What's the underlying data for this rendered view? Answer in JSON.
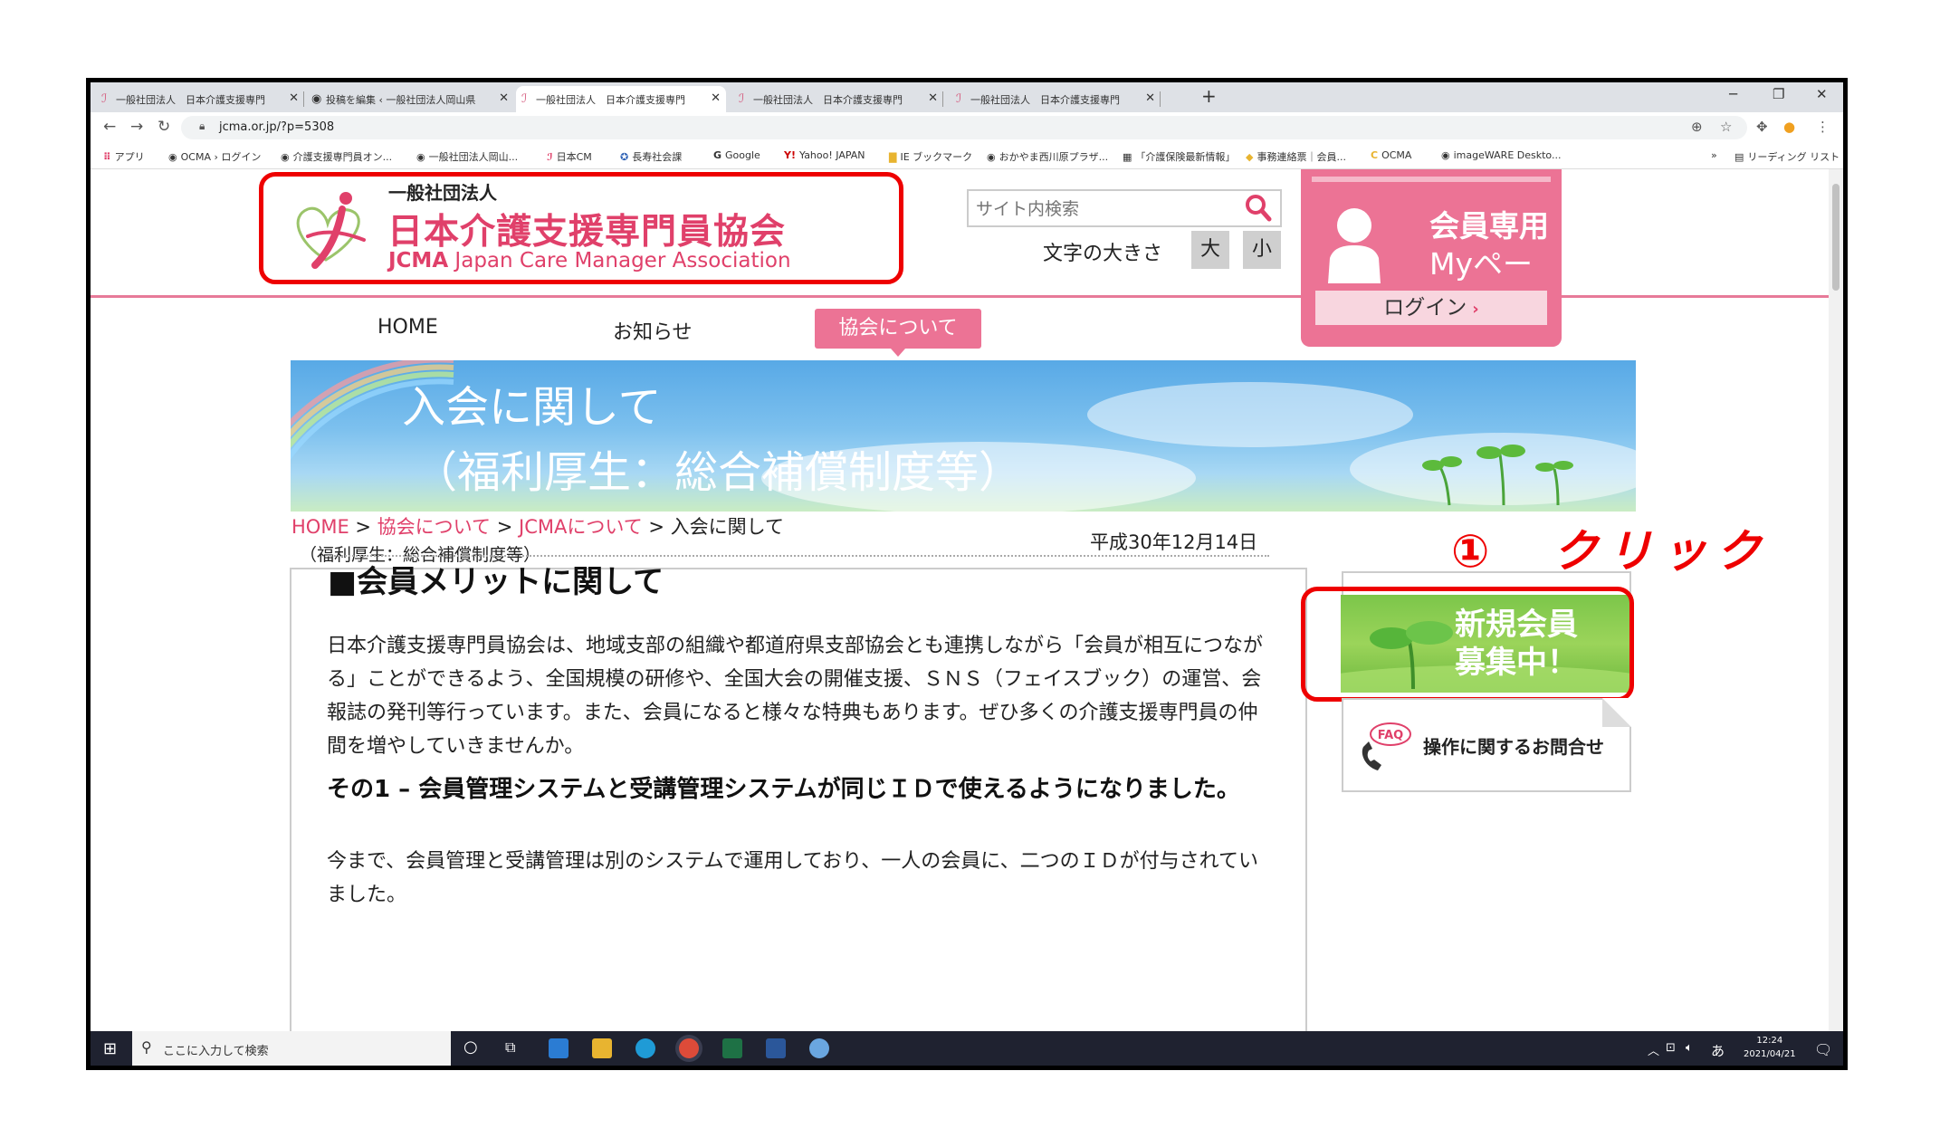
{
  "browser": {
    "tabs": [
      {
        "title": "一般社団法人　日本介護支援専門",
        "active": false
      },
      {
        "title": "投稿を編集 ‹ 一般社団法人岡山県",
        "active": false
      },
      {
        "title": "一般社団法人　日本介護支援専門",
        "active": true
      },
      {
        "title": "一般社団法人　日本介護支援専門",
        "active": false
      },
      {
        "title": "一般社団法人　日本介護支援専門",
        "active": false
      }
    ],
    "url": "jcma.or.jp/?p=5308",
    "bookmarks": [
      "アプリ",
      "OCMA › ログイン",
      "介護支援専門員オン...",
      "一般社団法人岡山...",
      "日本CM",
      "長寿社会課",
      "Google",
      "Yahoo! JAPAN",
      "IE ブックマーク",
      "おかやま西川原プラザ...",
      "「介護保険最新情報」",
      "事務連絡票｜会員...",
      "OCMA",
      "imageWARE Deskto..."
    ],
    "reading_list": "リーディング リスト",
    "more": "»"
  },
  "header": {
    "org_small": "一般社団法人",
    "org_big": "日本介護支援専門員協会",
    "org_en_bold": "JCMA",
    "org_en": " Japan Care Manager Association",
    "search_placeholder": "サイト内検索",
    "fontsize_label": "文字の大きさ",
    "fontsize_large": "大",
    "fontsize_small": "小",
    "member_title1": "会員専用",
    "member_title2": "Myページ",
    "login": "ログイン"
  },
  "nav": {
    "home": "HOME",
    "news": "お知らせ",
    "about": "協会について"
  },
  "banner": {
    "line1": "入会に関して",
    "line2": "（福利厚生：総合補償制度等）"
  },
  "breadcrumb": {
    "home": "HOME",
    "sep": " > ",
    "about": "協会について",
    "jcma": "JCMAについて",
    "current": "入会に関して",
    "current2": "（福利厚生：総合補償制度等）"
  },
  "article": {
    "date": "平成30年12月14日",
    "heading": "■会員メリットに関して",
    "body": "日本介護支援専門員協会は、地域支部の組織や都道府県支部協会とも連携しながら「会員が相互につながる」ことができるよう、全国規模の研修や、全国大会の開催支援、ＳＮＳ（フェイスブック）の運営、会報誌の発刊等行っています。また、会員になると様々な特典もあります。ぜひ多くの介護支援専門員の仲間を増やしていきませんか。",
    "sub_heading": "その1 – 会員管理システムと受講管理システムが同じＩＤで使えるようになりました。",
    "body2": "今まで、会員管理と受講管理は別のシステムで運用しており、一人の会員に、二つのＩＤが付与されていました。"
  },
  "sidebar": {
    "annotation": "①　クリック",
    "recruit": "新規会員\n募集中！",
    "faq_label": "FAQ",
    "faq": "操作に関するお問合せ"
  },
  "taskbar": {
    "search_placeholder": "ここに入力して検索",
    "ime": "あ",
    "time": "12:24",
    "date": "2021/04/21"
  },
  "colors": {
    "brand_pink": "#e0406a",
    "nav_pink": "#ec7395",
    "annotation_red": "#ee0000"
  }
}
